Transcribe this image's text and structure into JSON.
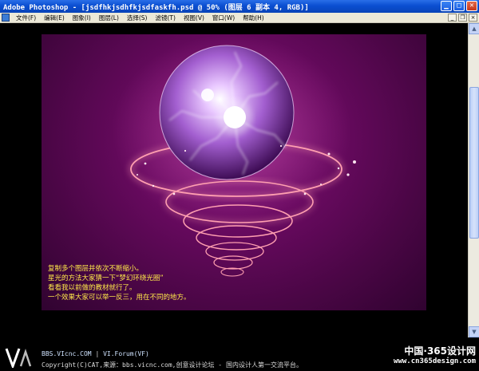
{
  "window": {
    "title": "Adobe Photoshop - [jsdfhkjsdhfkjsdfaskfh.psd @ 50% (图层 6 副本 4, RGB)]",
    "minimize_icon": "minimize-icon",
    "maximize_icon": "maximize-icon",
    "close_icon": "close-icon"
  },
  "menu": {
    "items": [
      "文件(F)",
      "编辑(E)",
      "图象(I)",
      "图层(L)",
      "选择(S)",
      "滤镜(T)",
      "视图(V)",
      "窗口(W)",
      "帮助(H)"
    ]
  },
  "canvas": {
    "caption_lines": [
      "复制多个图层并依次不断缩小。",
      "星光的方法大家猜一下“梦幻环绕光圈”",
      "看看我以前做的教材就行了。",
      "一个效果大家可以举一反三，用在不同的地方。"
    ],
    "colors": {
      "background": "#6a0a61",
      "orb": "#c8a0e8",
      "ring": "#ff9fb0",
      "caption": "#ffe94a"
    }
  },
  "footer": {
    "line1_site": "BBS.VIcnc.COM",
    "line1_sep": " | ",
    "line1_forum": "VI.Forum(VF)",
    "line2": "Copyright(C)CAT,来源：bbs.vicnc.com,创意设计论坛 - 国内设计人第一交流平台。",
    "watermark_line1": "中国·365设计网",
    "watermark_line2": "www.cn365design.com"
  }
}
